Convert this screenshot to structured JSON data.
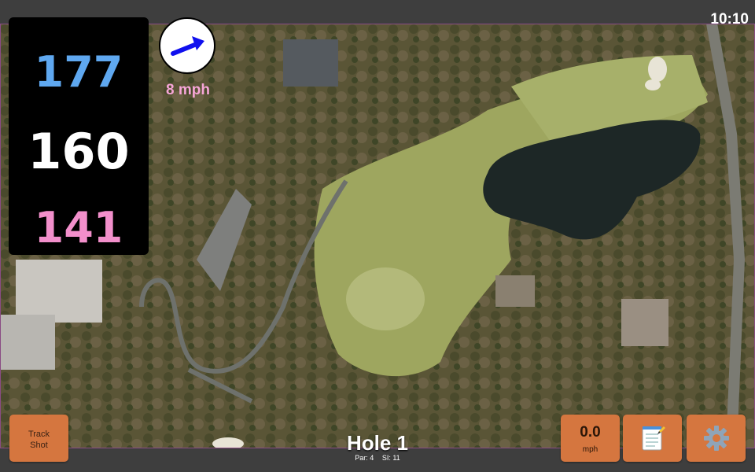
{
  "status": {
    "time": "10:10"
  },
  "distances": {
    "back": "177",
    "middle": "160",
    "front": "141"
  },
  "wind": {
    "speed_label": "8 mph",
    "icon": "wind-direction-arrow-icon"
  },
  "hole": {
    "title": "Hole 1",
    "par": "Par: 4",
    "si": "SI: 11"
  },
  "buttons": {
    "track_shot": "Track\nShot",
    "speed_value": "0.0",
    "speed_unit": "mph",
    "notes_icon": "notepad-icon",
    "settings_icon": "gear-icon"
  },
  "colors": {
    "back_distance": "#5fa8f0",
    "middle_distance": "#ffffff",
    "front_distance": "#f28fcb",
    "button": "#d5763f"
  }
}
